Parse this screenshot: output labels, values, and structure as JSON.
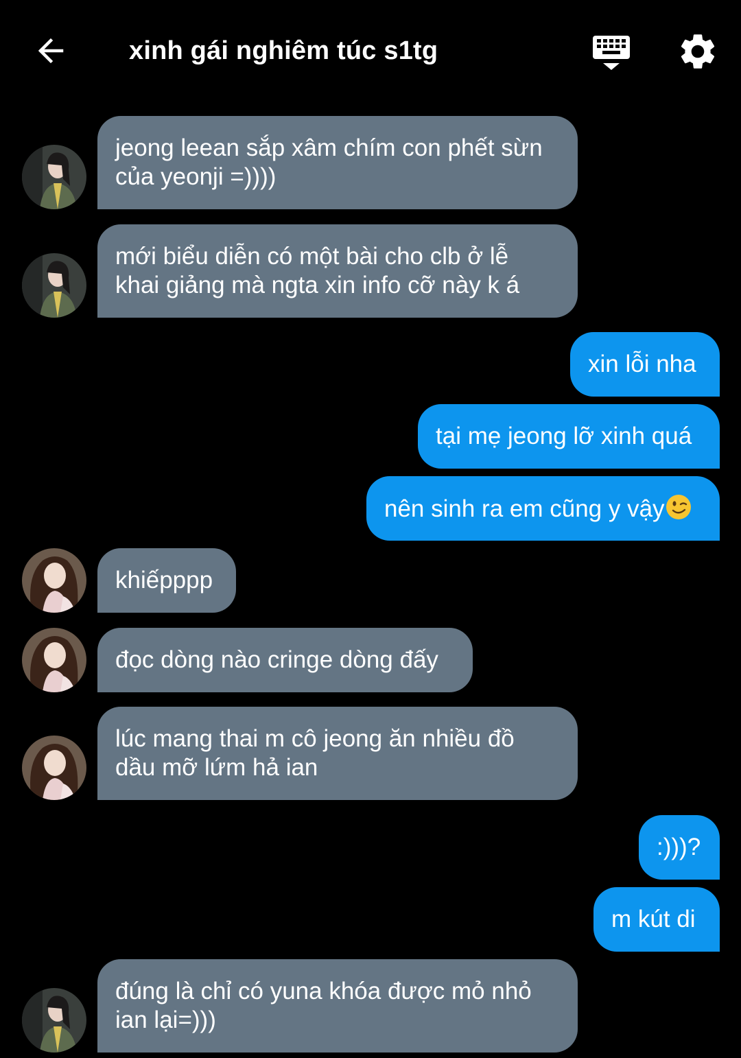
{
  "header": {
    "title": "xinh gái nghiêm túc s1tg",
    "back_icon": "arrow-left-icon",
    "keyboard_icon": "keyboard-icon",
    "settings_icon": "gear-icon"
  },
  "colors": {
    "incoming_bubble": "#647584",
    "outgoing_bubble": "#0d95ee",
    "background": "#000000"
  },
  "messages": [
    {
      "direction": "incoming",
      "lines": [
        "jeong leean sắp xâm chím con phết sừn",
        "của yeonji =))))"
      ],
      "avatar": "avatar-a"
    },
    {
      "direction": "incoming",
      "lines": [
        "mới biểu diễn có một bài cho clb ở lễ",
        "khai giảng mà ngta xin info cỡ này k á"
      ],
      "avatar": "avatar-a"
    },
    {
      "direction": "outgoing",
      "lines": [
        "xin lỗi nha"
      ]
    },
    {
      "direction": "outgoing",
      "lines": [
        "tại mẹ jeong lỡ xinh quá"
      ]
    },
    {
      "direction": "outgoing",
      "lines": [
        "nên sinh ra em cũng y vậy"
      ],
      "emoji": "winking-face-emoji"
    },
    {
      "direction": "incoming",
      "lines": [
        "khiếpppp"
      ],
      "avatar": "avatar-b"
    },
    {
      "direction": "incoming",
      "lines": [
        "đọc dòng nào cringe dòng đấy"
      ],
      "avatar": "avatar-b"
    },
    {
      "direction": "incoming",
      "lines": [
        "lúc mang thai m cô jeong ăn nhiều đồ",
        "dầu mỡ lứm hả ian"
      ],
      "avatar": "avatar-b"
    },
    {
      "direction": "outgoing",
      "lines": [
        ":)))?"
      ]
    },
    {
      "direction": "outgoing",
      "lines": [
        "m kút di"
      ]
    },
    {
      "direction": "incoming",
      "lines": [
        "đúng là chỉ có yuna khóa được mỏ nhỏ",
        "ian lại=)))"
      ],
      "avatar": "avatar-a"
    }
  ]
}
